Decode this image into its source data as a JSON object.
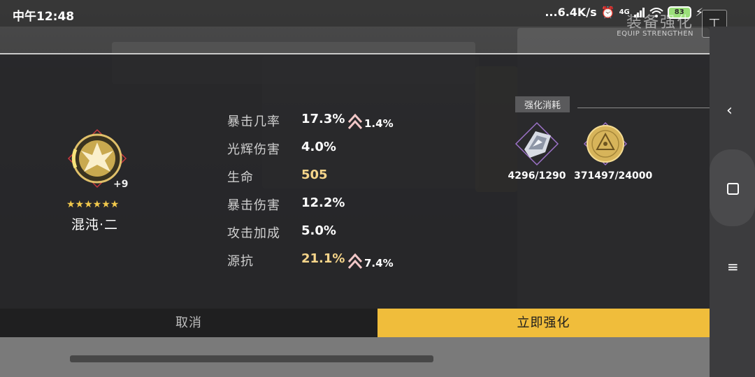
{
  "status_bar": {
    "time": "中午12:48",
    "network_speed": "...6.4K/s",
    "signal": "4G",
    "battery": "83"
  },
  "header": {
    "title": "装备强化",
    "subtitle": "EQUIP STRENGTHEN"
  },
  "equipment": {
    "name": "混沌·二",
    "level": "+9",
    "stars": "★★★★★★",
    "accent_color": "#e0c06a"
  },
  "stats": [
    {
      "label": "暴击几率",
      "value": "17.3%",
      "increase": "1.4%",
      "highlight": false
    },
    {
      "label": "光辉伤害",
      "value": "4.0%",
      "increase": "",
      "highlight": false
    },
    {
      "label": "生命",
      "value": "505",
      "increase": "",
      "highlight": true
    },
    {
      "label": "暴击伤害",
      "value": "12.2%",
      "increase": "",
      "highlight": false
    },
    {
      "label": "攻击加成",
      "value": "5.0%",
      "increase": "",
      "highlight": false
    },
    {
      "label": "源抗",
      "value": "21.1%",
      "increase": "7.4%",
      "highlight": true
    }
  ],
  "cost": {
    "label": "强化消耗",
    "items": [
      {
        "icon": "material-crystal-icon",
        "count": "4296/1290"
      },
      {
        "icon": "gold-coin-icon",
        "count": "371497/24000"
      }
    ]
  },
  "buttons": {
    "cancel": "取消",
    "confirm": "立即强化"
  },
  "colors": {
    "confirm_bg": "#f0bd3b",
    "gold_text": "#f6d58a",
    "increase_arrow": "#f2c7c7"
  }
}
